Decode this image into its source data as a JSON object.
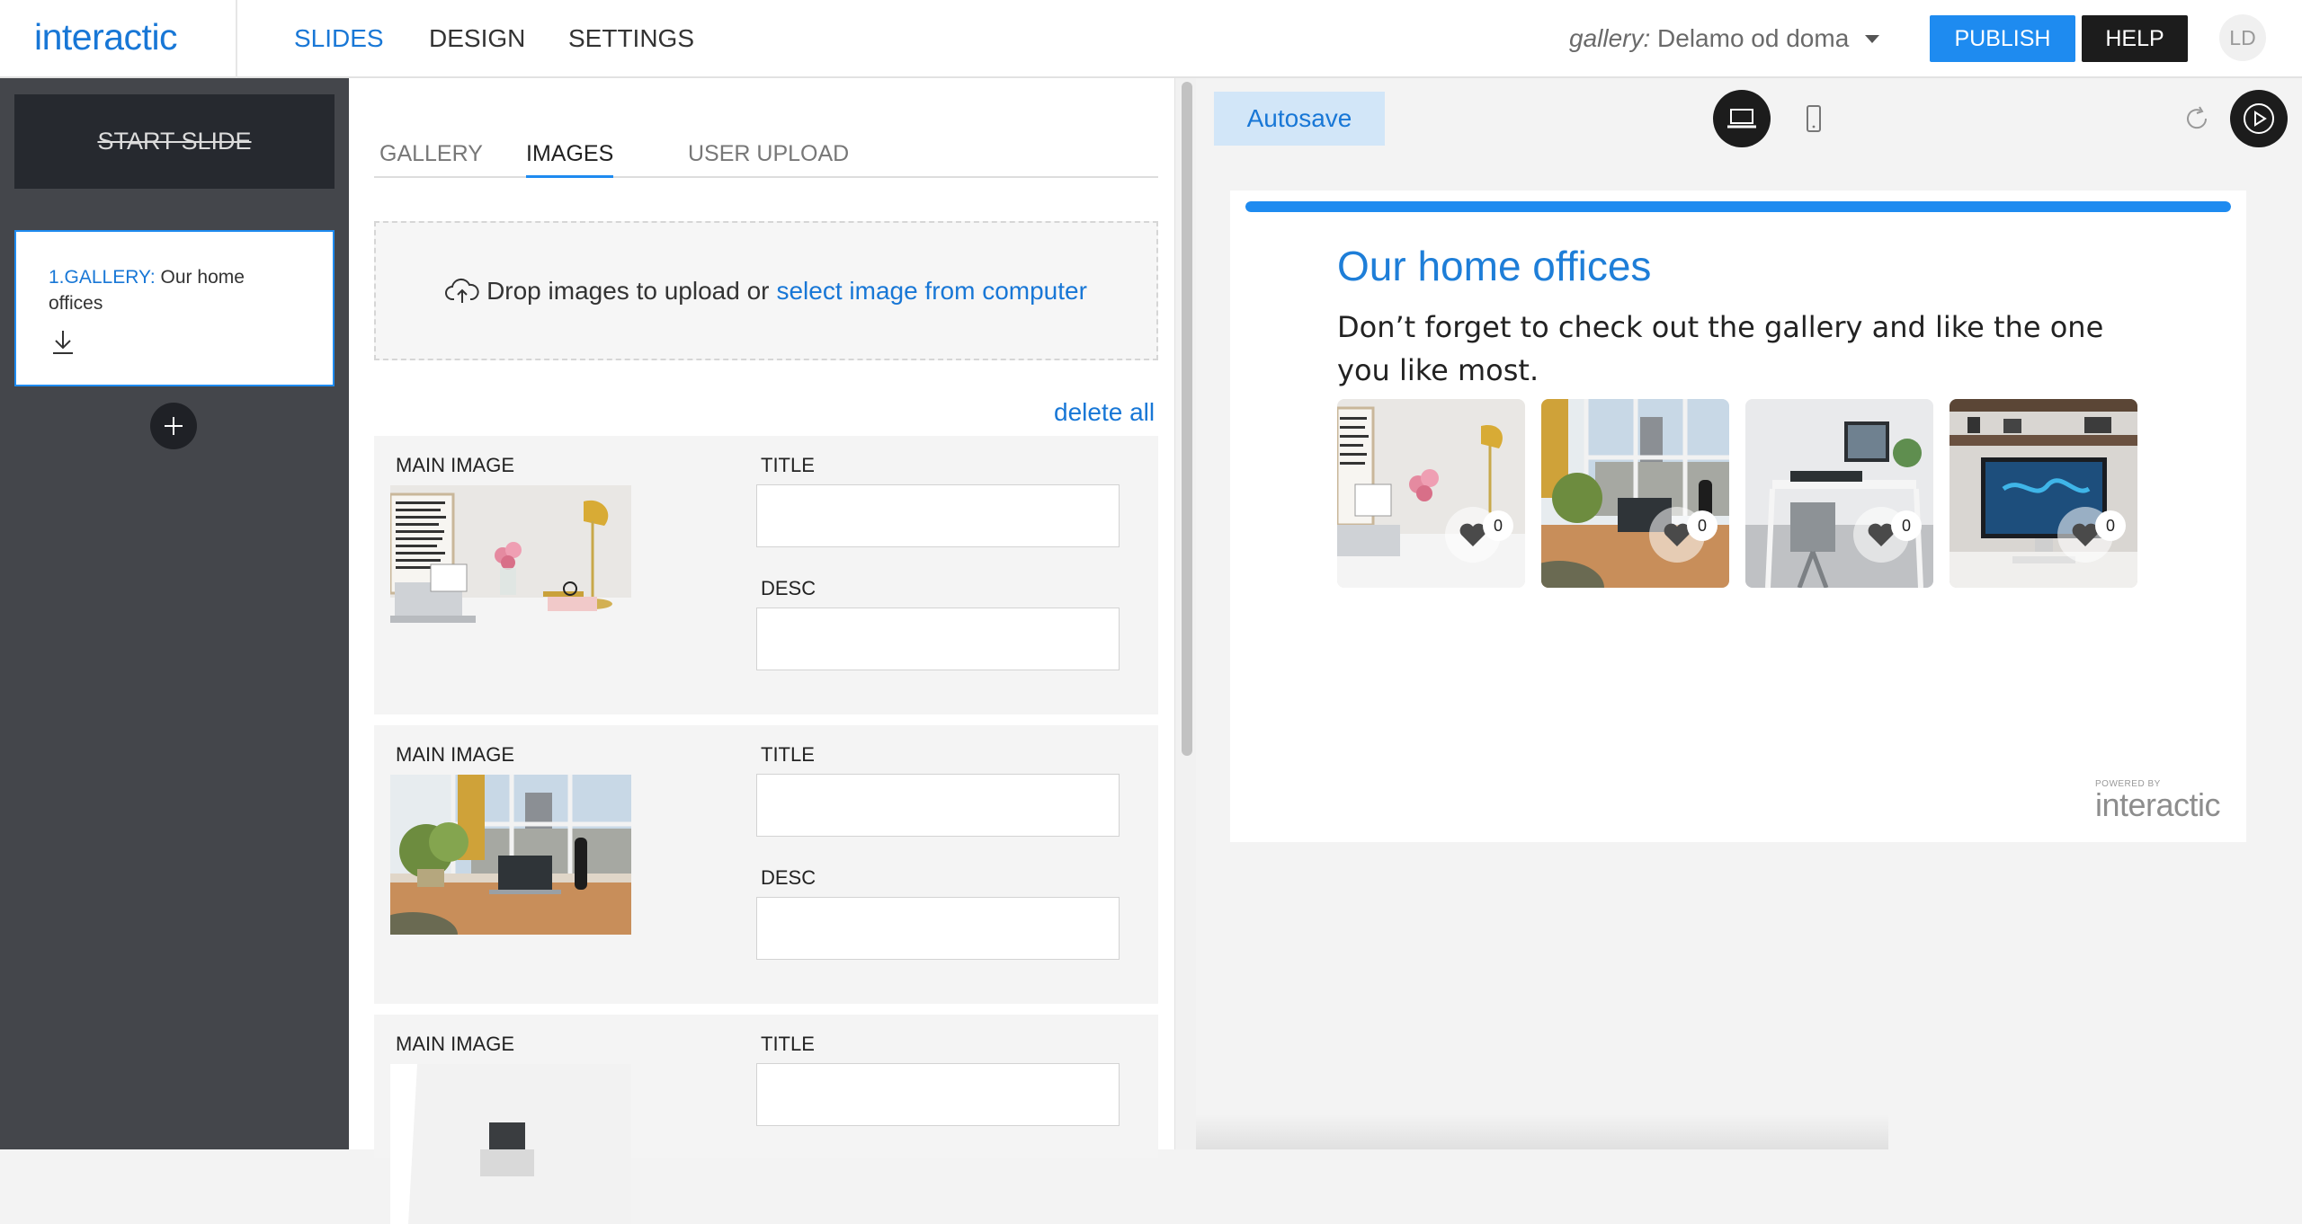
{
  "app": {
    "logo": "interactic"
  },
  "nav": {
    "items": [
      {
        "label": "SLIDES",
        "active": true
      },
      {
        "label": "DESIGN",
        "active": false
      },
      {
        "label": "SETTINGS",
        "active": false
      }
    ]
  },
  "project": {
    "type_label": "gallery:",
    "name": "Delamo od doma"
  },
  "header_actions": {
    "publish": "PUBLISH",
    "help": "HELP",
    "avatar_initials": "LD"
  },
  "sidebar": {
    "start_slide": "START SLIDE",
    "slides": [
      {
        "kind": "1.GALLERY:",
        "title": "Our home offices"
      }
    ]
  },
  "editor": {
    "tabs": [
      {
        "label": "GALLERY",
        "active": false
      },
      {
        "label": "IMAGES",
        "active": true
      },
      {
        "label": "USER UPLOAD",
        "active": false
      }
    ],
    "dropzone": {
      "text": "Drop images to upload or",
      "link": "select image from computer"
    },
    "delete_all": "delete all",
    "items": [
      {
        "main_image_label": "MAIN IMAGE",
        "title_label": "TITLE",
        "title_value": "",
        "desc_label": "DESC",
        "desc_value": ""
      },
      {
        "main_image_label": "MAIN IMAGE",
        "title_label": "TITLE",
        "title_value": "",
        "desc_label": "DESC",
        "desc_value": ""
      },
      {
        "main_image_label": "MAIN IMAGE",
        "title_label": "TITLE",
        "title_value": ""
      }
    ]
  },
  "preview": {
    "autosave": "Autosave",
    "progress_fraction": 1.0,
    "title": "Our home offices",
    "description": "Don’t forget to check out the gallery and like the one you like most.",
    "gallery": [
      {
        "likes": "0"
      },
      {
        "likes": "0"
      },
      {
        "likes": "0"
      },
      {
        "likes": "0"
      }
    ],
    "powered_by": "POWERED BY",
    "powered_brand": "interactic"
  },
  "colors": {
    "accent": "#1e8bf0",
    "link": "#1877d6",
    "sidebar_bg": "#44464b",
    "dark_button": "#1c1c1c"
  }
}
